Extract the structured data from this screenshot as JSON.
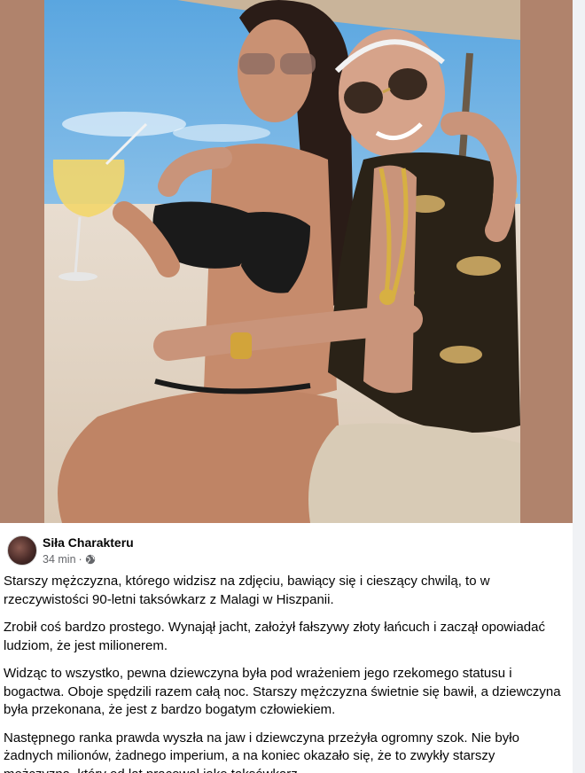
{
  "post": {
    "author": "Siła Charakteru",
    "time": "34 min",
    "separator": "·",
    "privacy_icon": "globe-icon",
    "paragraphs": [
      "Starszy mężczyzna, którego widzisz na zdjęciu, bawiący się i cieszący chwilą, to w rzeczywistości 90-letni taksówkarz z Malagi w Hiszpanii.",
      "Zrobił coś bardzo prostego. Wynajął jacht, założył fałszywy złoty łańcuch i zaczął opowiadać ludziom, że jest milionerem.",
      "Widząc to wszystko, pewna dziewczyna była pod wrażeniem jego rzekomego statusu i bogactwa. Oboje spędzili razem całą noc. Starszy mężczyzna świetnie się bawił, a dziewczyna była przekonana, że jest z bardzo bogatym człowiekiem.",
      "Następnego ranka prawda wyszła na jaw i dziewczyna przeżyła ogromny szok. Nie było żadnych milionów, żadnego imperium, a na koniec okazało się, że to zwykły starszy mężczyzna, który od lat pracował jako taksówkarz."
    ]
  },
  "colors": {
    "frame": "#b0836c",
    "text": "#050505",
    "meta": "#65676b"
  }
}
